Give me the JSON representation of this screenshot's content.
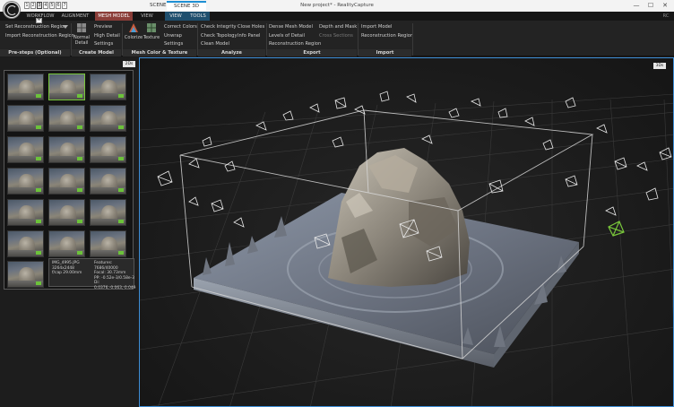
{
  "titlebar": {
    "window_title": "New project* - RealityCapture",
    "quick_nums": [
      "1",
      "2",
      "3",
      "4",
      "5",
      "6",
      "7"
    ],
    "tabs": [
      "SCENE 2D",
      "SCENE 3D"
    ],
    "buttons": [
      "—",
      "☐",
      "✕"
    ]
  },
  "ribbon": {
    "tabs": [
      "WORKFLOW",
      "ALIGNMENT",
      "MESH MODEL",
      "VIEW",
      "VIEW",
      "TOOLS"
    ],
    "key_hint": "M",
    "preprocess": {
      "set_region": "Set Reconstruction Region",
      "import_region": "Import Reconstruction Region"
    },
    "create_model": {
      "normal": "Normal",
      "detail": "Detail",
      "preview": "Preview",
      "high_detail": "High Detail",
      "settings": "Settings"
    },
    "color_texture": {
      "colorize": "Colorize",
      "texture": "Texture",
      "correct_colors": "Correct Colors",
      "unwrap": "Unwrap",
      "settings": "Settings"
    },
    "analyze": {
      "check_integrity": "Check Integrity",
      "check_topology": "Check Topology",
      "clean_model": "Clean Model",
      "close_holes": "Close Holes",
      "info_panel": "Info Panel"
    },
    "export": {
      "dense_mesh": "Dense Mesh Model",
      "levels_of_detail": "Levels of Detail",
      "reconstruction_region": "Reconstruction Region",
      "depth_and_mask": "Depth and Mask",
      "cross_sections": "Cross Sections"
    },
    "import": {
      "import_model": "Import Model",
      "reconstruction_region": "Reconstruction Region"
    },
    "groups": [
      "Pre-steps (Optional)",
      "Create Model",
      "Mesh Color & Texture",
      "Analyze",
      "Export",
      "Import"
    ],
    "corner_badge": "RC"
  },
  "left_panel": {
    "badge": "2Ds",
    "tooltip": {
      "filename": "IMG_4995.JPG",
      "resolution": "3264x2448",
      "focal": "f/cap 29.00mm",
      "features": "Features: 7686/40000",
      "focal_35": "Focal: 30.73mm",
      "pp": "PP: -0.52e-3/0.58e-3",
      "dist": "Di: 0.0376,-0.063,-0.049"
    }
  },
  "view3d": {
    "badge": "3Ds"
  },
  "colors": {
    "accent_blue": "#3e8fd8",
    "active_tab": "#8b3e39",
    "selected_green": "#78c63a"
  }
}
